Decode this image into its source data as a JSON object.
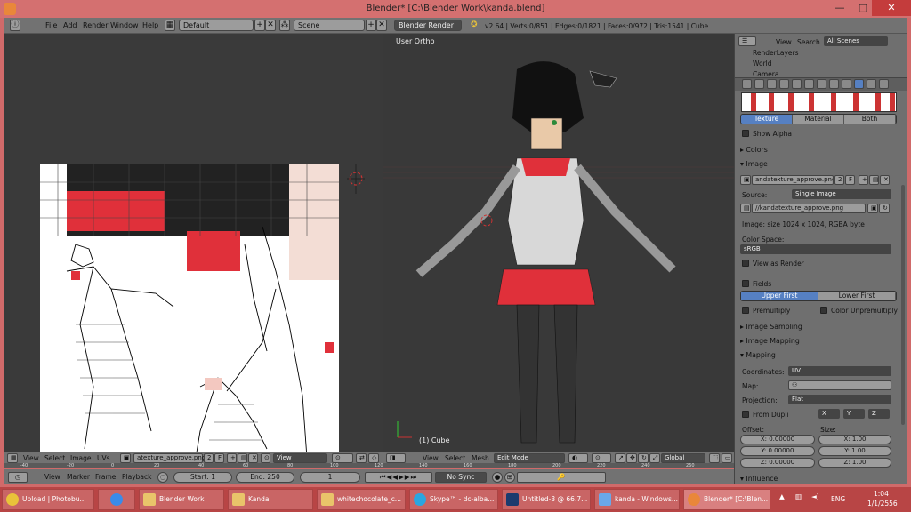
{
  "window": {
    "title": "Blender* [C:\\Blender Work\\kanda.blend]",
    "min": "—",
    "max": "□",
    "close": "✕"
  },
  "header": {
    "menus": [
      "File",
      "Add",
      "Render",
      "Window",
      "Help"
    ],
    "layout": "Default",
    "scene": "Scene",
    "engine": "Blender Render",
    "stats": "v2.64 | Verts:0/851 | Edges:0/1821 | Faces:0/972 | Tris:1541 | Cube"
  },
  "uv_editor": {
    "menus": [
      "View",
      "Select",
      "Image",
      "UVs"
    ],
    "image_name": "atexture_approve.png",
    "users": "2",
    "fake": "F",
    "view_mode": "View"
  },
  "viewport": {
    "view_label": "User Ortho",
    "object_label": "(1) Cube",
    "menus": [
      "View",
      "Select",
      "Mesh"
    ],
    "mode": "Edit Mode",
    "orientation": "Global"
  },
  "timeline": {
    "ruler": [
      "-40",
      "-20",
      "0",
      "20",
      "40",
      "60",
      "80",
      "100",
      "120",
      "140",
      "160",
      "180",
      "200",
      "220",
      "240",
      "260"
    ],
    "menus": [
      "View",
      "Marker",
      "Frame",
      "Playback"
    ],
    "start": "Start: 1",
    "end": "End: 250",
    "current": "1",
    "sync": "No Sync"
  },
  "outliner": {
    "menus": [
      "View",
      "Search"
    ],
    "filter": "All Scenes",
    "items": [
      "RenderLayers",
      "World",
      "Camera"
    ]
  },
  "properties": {
    "tabs": [
      "Texture",
      "Material",
      "Both"
    ],
    "show_alpha": "Show Alpha",
    "colors": "Colors",
    "image": "Image",
    "image_name": "andatexture_approve.png",
    "users": "2",
    "fake": "F",
    "source_label": "Source:",
    "source": "Single Image",
    "filepath": "//kandatexture_approve.png",
    "image_info": "Image: size 1024 x 1024, RGBA byte",
    "color_space_label": "Color Space:",
    "color_space": "sRGB",
    "view_as_render": "View as Render",
    "fields": "Fields",
    "field_order": [
      "Upper First",
      "Lower First"
    ],
    "premultiply": "Premultiply",
    "color_unpremultiply": "Color Unpremultiply",
    "image_sampling": "Image Sampling",
    "image_mapping": "Image Mapping",
    "mapping": "Mapping",
    "coordinates_label": "Coordinates:",
    "coordinates": "UV",
    "map_label": "Map:",
    "projection_label": "Projection:",
    "projection": "Flat",
    "from_dupli": "From Dupli",
    "axes": [
      "X",
      "Y",
      "Z"
    ],
    "offset_label": "Offset:",
    "size_label": "Size:",
    "offset": [
      "X: 0.00000",
      "Y: 0.00000",
      "Z: 0.00000"
    ],
    "size": [
      "X: 1.00",
      "Y: 1.00",
      "Z: 1.00"
    ],
    "influence": "Influence"
  },
  "taskbar": {
    "items": [
      "Upload | Photobu...",
      "",
      "Blender Work",
      "Kanda",
      "whitechocolate_c...",
      "Skype™ - dc-alba...",
      "Untitled-3 @ 66.7...",
      "kanda - Windows...",
      "Blender* [C:\\Blen..."
    ],
    "lang": "ENG",
    "time": "1:04",
    "date": "1/1/2556"
  },
  "colors": {
    "accent": "#5680c2",
    "titlebar": "#d47070",
    "taskbar": "#b84545",
    "mesh_red": "#e0303a"
  }
}
